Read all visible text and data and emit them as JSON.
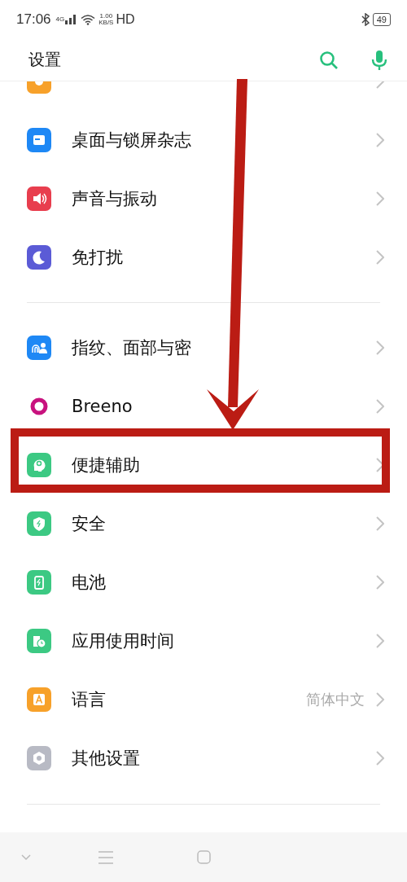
{
  "status_bar": {
    "time": "17:06",
    "network": "4G",
    "speed": "1.00",
    "speed_unit": "KB/S",
    "hd": "HD",
    "battery": "49"
  },
  "header": {
    "title": "设置"
  },
  "groups": [
    [
      {
        "kind": "display",
        "color": "#f7a12a",
        "clipped": true
      },
      {
        "kind": "wallpaper",
        "color": "#1e88f5",
        "label": "桌面与锁屏杂志"
      },
      {
        "kind": "sound",
        "color": "#e83e4e",
        "label": "声音与振动"
      },
      {
        "kind": "moon",
        "color": "#5b5bd6",
        "label": "免打扰"
      }
    ],
    [
      {
        "kind": "fingerprint",
        "color": "#1e88f5",
        "label": "指纹、面部与密"
      },
      {
        "kind": "ring",
        "color": "#c8127e",
        "label": "Breeno"
      },
      {
        "kind": "head",
        "color": "#3cc983",
        "label": "便捷辅助"
      },
      {
        "kind": "shield",
        "color": "#3cc983",
        "label": "安全"
      },
      {
        "kind": "battery",
        "color": "#3cc983",
        "label": "电池"
      },
      {
        "kind": "clock",
        "color": "#3cc983",
        "label": "应用使用时间"
      },
      {
        "kind": "letter",
        "color": "#f7a12a",
        "label": "语言",
        "value": "简体中文"
      },
      {
        "kind": "gear",
        "color": "#b8bac4",
        "label": "其他设置"
      }
    ]
  ],
  "annotations": {
    "arrow": true,
    "highlight_frame": true
  }
}
